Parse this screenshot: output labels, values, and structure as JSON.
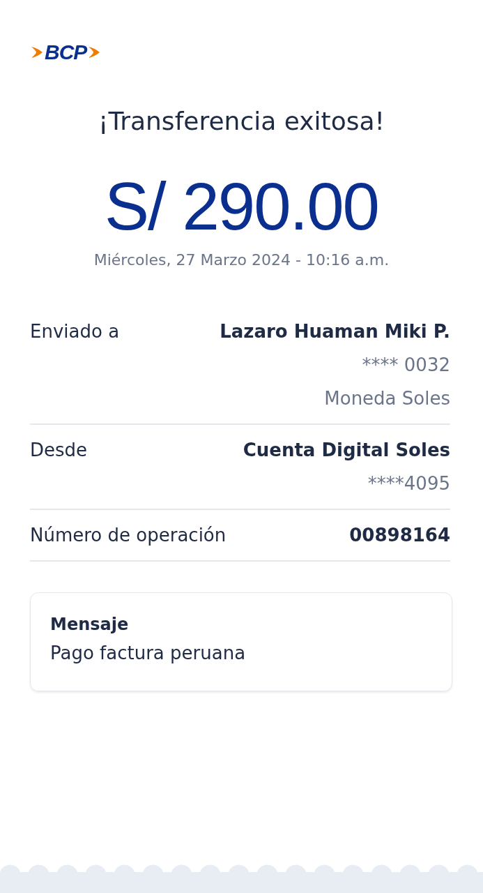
{
  "logo": {
    "text": "BCP"
  },
  "title": "¡Transferencia exitosa!",
  "amount": "S/ 290.00",
  "datetime": "Miércoles, 27 Marzo 2024 - 10:16 a.m.",
  "details": [
    {
      "label": "Enviado a",
      "lines": [
        "Lazaro Huaman Miki P.",
        "**** 0032",
        "Moneda Soles"
      ]
    },
    {
      "label": "Desde",
      "lines": [
        "Cuenta Digital Soles",
        "****4095"
      ]
    },
    {
      "label": "Número de operación",
      "lines": [
        "00898164"
      ]
    }
  ],
  "message": {
    "title": "Mensaje",
    "text": "Pago factura peruana"
  }
}
